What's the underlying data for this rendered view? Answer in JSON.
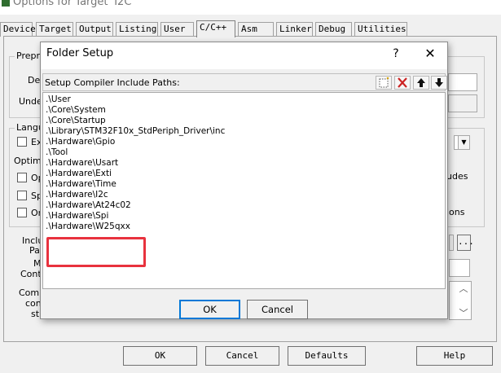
{
  "window": {
    "title": "Options for Target 'I2C'"
  },
  "tabs": [
    "Device",
    "Target",
    "Output",
    "Listing",
    "User",
    "C/C++",
    "Asm",
    "Linker",
    "Debug",
    "Utilities"
  ],
  "back": {
    "preproc": "Prepro",
    "define": "Def",
    "undefine": "Unde",
    "language": "Langu",
    "ex": "Ex",
    "optimiz": "Optimiz",
    "op": "Op",
    "sp": "Sp",
    "on": "On",
    "udes": "udes",
    "ions": "ions",
    "include": "Inclu",
    "paths": "Pat",
    "misc": "M",
    "controls": "Contr",
    "compiler": "Comp",
    "control": "con",
    "string": "str",
    "browse": "...",
    "buttons": {
      "ok": "OK",
      "cancel": "Cancel",
      "defaults": "Defaults",
      "help": "Help"
    }
  },
  "dialog": {
    "title": "Folder Setup",
    "help": "?",
    "close": "✕",
    "header": "Setup Compiler Include Paths:",
    "paths": [
      ".\\User",
      ".\\Core\\System",
      ".\\Core\\Startup",
      ".\\Library\\STM32F10x_StdPeriph_Driver\\inc",
      ".\\Hardware\\Gpio",
      ".\\Tool",
      ".\\Hardware\\Usart",
      ".\\Hardware\\Exti",
      ".\\Hardware\\Time",
      ".\\Hardware\\I2c",
      ".\\Hardware\\At24c02",
      ".\\Hardware\\Spi",
      ".\\Hardware\\W25qxx"
    ],
    "ok": "OK",
    "cancel": "Cancel"
  },
  "colors": {
    "highlight": "#e8323e",
    "default_button": "#0078d7",
    "delete_icon": "#cc2222"
  }
}
